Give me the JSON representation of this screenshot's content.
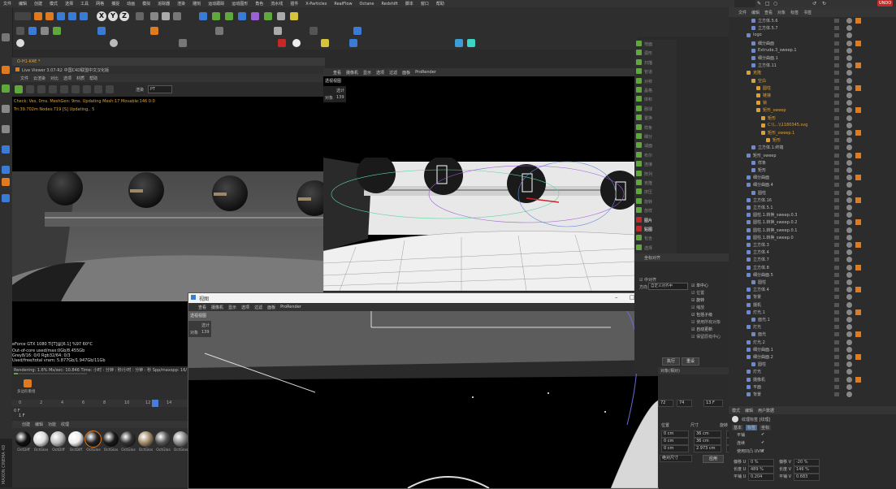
{
  "menubar": [
    "文件",
    "编辑",
    "创建",
    "模式",
    "选择",
    "工具",
    "网格",
    "捕捉",
    "动画",
    "模拟",
    "追踪器",
    "渲染",
    "雕刻",
    "运动跟踪",
    "运动图形",
    "角色",
    "流水线",
    "插件",
    "X-Particles",
    "RealFlow",
    "Octane",
    "Redshift",
    "脚本",
    "窗口",
    "帮助"
  ],
  "right_menu": [
    "文件",
    "编辑",
    "查看",
    "对象",
    "标签",
    "书签"
  ],
  "corner_badge": "UNDO",
  "toolbar_axis": [
    "X",
    "Y",
    "Z"
  ],
  "live_viewer": {
    "header_tab": "O-H1-K4E *",
    "title": "Live Viewer 3.07-R2 中国C4D联盟中文汉化版",
    "menus": [
      "文件",
      "云渲染",
      "对比",
      "选项",
      "材质",
      "帮助"
    ],
    "mode_label": "渲染",
    "mode_value": "PT",
    "status_line": "Check: Ves, 0ms. MeshGen: 9ms. Updating Mesh:17 Movable:146 0:0",
    "tri_line": "Tri:39.702m Nodes:719 [S] Updating..   5",
    "gpu_line": "eForce GTX 1080 Ti[T]@[6.1] %97     60°C",
    "core_line": "Out-of-core used/max:0Gb/8.455Gb",
    "rgb_line": "Grey8/16: 0/0          Rgb32/64: 0/3",
    "vram_line": "Used/free/total vram: 5.877Gb/1.947Gb/11Gb",
    "render_line": "Rendering: 1.6%   Ms/sec: 10.846   Time: 小时 : 分钟 : 秒/小时 : 分钟 : 秒   Spp/maxspp: 16/1000"
  },
  "viewport_top": {
    "menus": [
      "查看",
      "摄像机",
      "显示",
      "选项",
      "过滤",
      "面板",
      "ProRender"
    ],
    "label": "透视视图",
    "hud_label": "选计",
    "hud_obj": "对象",
    "hud_count": "139"
  },
  "viewport_float": {
    "window_title": "视图",
    "menus": [
      "查看",
      "摄像机",
      "显示",
      "选项",
      "过滤",
      "面板",
      "ProRender"
    ],
    "label": "透视视图",
    "hud_label": "选计",
    "hud_obj": "对象",
    "hud_count": "139"
  },
  "timeline": {
    "ticks": [
      "0",
      "2",
      "4",
      "6",
      "8",
      "10",
      "12",
      "14",
      "16",
      "18"
    ],
    "current": "1 F",
    "frame_a": "0 F",
    "label": "多边形重组"
  },
  "material_bar": {
    "menus": [
      "创建",
      "编辑",
      "功能",
      "纹理"
    ],
    "swatches": [
      "OctDiff",
      "OctGlos",
      "OctDiff",
      "OctDiff",
      "OctGlos",
      "OctGlos",
      "OctGlos",
      "OctGlos",
      "OctGlos",
      "OctGlos"
    ],
    "swatch_colors": [
      "#111",
      "#ddd",
      "#bbb",
      "#eee",
      "#222",
      "#1a1a1a",
      "#333",
      "#a08a6a",
      "#555",
      "#888"
    ],
    "logo": "MAXON CINEMA 4D"
  },
  "mid_panel": {
    "items": [
      "地面",
      "弧形",
      "扫描",
      "管道",
      "对称",
      "晶格",
      "体积",
      "融球",
      "置换",
      "样条",
      "细分",
      "减面",
      "布尔",
      "连接",
      "阵列",
      "克隆",
      "挤压",
      "旋转",
      "放样",
      "图片",
      "贴图",
      "包含",
      "选择"
    ],
    "highlighted": [
      "图片",
      "贴图"
    ],
    "section_title": "坐标对齐",
    "check_label": "中对齐",
    "dir_label": "方向",
    "dir_value": "自定义对齐中",
    "opts": [
      "单中心",
      "位置",
      "旋转",
      "缩放",
      "包括子级",
      "使用所有对象",
      "自动更新",
      "保留原有中心"
    ],
    "apply_btn": "执行",
    "reset_btn": "重设"
  },
  "coord_panel": {
    "tabs": [
      "位置",
      "尺寸",
      "旋转"
    ],
    "rows": [
      [
        "0 cm",
        "36 cm",
        "H 0°"
      ],
      [
        "0 cm",
        "36 cm",
        "P 0°"
      ],
      [
        "0 cm",
        "2.973 cm",
        "B 0°"
      ]
    ],
    "mode_select": "对象(相对)",
    "size_select": "绝对尺寸",
    "apply": "应用",
    "nums": [
      "72",
      "74",
      "13 F"
    ]
  },
  "object_list": {
    "items": [
      {
        "name": "立方体.5.6",
        "level": 1,
        "color": "#bcbcbc"
      },
      {
        "name": "立方体.5.7",
        "level": 1,
        "color": "#bcbcbc"
      },
      {
        "name": "logo",
        "level": 0,
        "color": "#bcbcbc"
      },
      {
        "name": "细分曲面",
        "level": 1,
        "color": "#bcbcbc"
      },
      {
        "name": "Extrude.3_sweep.1",
        "level": 1,
        "color": "#bcbcbc"
      },
      {
        "name": "细分曲面.1",
        "level": 1,
        "color": "#bcbcbc"
      },
      {
        "name": "立方体.11",
        "level": 1,
        "color": "#bcbcbc"
      },
      {
        "name": "克隆",
        "level": 0,
        "color": "#e0a030"
      },
      {
        "name": "空白",
        "level": 1,
        "color": "#e0a030"
      },
      {
        "name": "圆柱",
        "level": 2,
        "color": "#e0a030"
      },
      {
        "name": "链接",
        "level": 2,
        "color": "#e0a030"
      },
      {
        "name": "锁",
        "level": 2,
        "color": "#e0a030"
      },
      {
        "name": "矩形_sweep",
        "level": 2,
        "color": "#e0a030"
      },
      {
        "name": "矩形",
        "level": 3,
        "color": "#e0a030"
      },
      {
        "name": "C:\\\\...\\\\1180345.svg",
        "level": 3,
        "color": "#e0a030"
      },
      {
        "name": "矩形_sweep.1",
        "level": 3,
        "color": "#e0a030"
      },
      {
        "name": "矩形",
        "level": 4,
        "color": "#e0a030"
      },
      {
        "name": "立方体.1.终端",
        "level": 1,
        "color": "#bcbcbc"
      },
      {
        "name": "矩形_sweep",
        "level": 0,
        "color": "#bcbcbc"
      },
      {
        "name": "样条",
        "level": 1,
        "color": "#bcbcbc"
      },
      {
        "name": "矩形",
        "level": 1,
        "color": "#bcbcbc"
      },
      {
        "name": "细分曲面",
        "level": 0,
        "color": "#bcbcbc"
      },
      {
        "name": "细分曲面.4",
        "level": 0,
        "color": "#bcbcbc"
      },
      {
        "name": "圆柱",
        "level": 1,
        "color": "#bcbcbc"
      },
      {
        "name": "立方体.16",
        "level": 0,
        "color": "#bcbcbc"
      },
      {
        "name": "立方体.5.1",
        "level": 0,
        "color": "#bcbcbc"
      },
      {
        "name": "圆柱.1.转换_sweep.0.3",
        "level": 0,
        "color": "#bcbcbc"
      },
      {
        "name": "圆柱.1.转换_sweep.0.2",
        "level": 0,
        "color": "#bcbcbc"
      },
      {
        "name": "圆柱.1.转换_sweep.0.1",
        "level": 0,
        "color": "#bcbcbc"
      },
      {
        "name": "圆柱.1.转换_sweep.0",
        "level": 0,
        "color": "#bcbcbc"
      },
      {
        "name": "立方体.3",
        "level": 0,
        "color": "#bcbcbc"
      },
      {
        "name": "立方体.4",
        "level": 0,
        "color": "#bcbcbc"
      },
      {
        "name": "立方体.7",
        "level": 0,
        "color": "#bcbcbc"
      },
      {
        "name": "立方体.8",
        "level": 0,
        "color": "#bcbcbc"
      },
      {
        "name": "细分曲面.5",
        "level": 0,
        "color": "#bcbcbc"
      },
      {
        "name": "圆柱",
        "level": 1,
        "color": "#bcbcbc"
      },
      {
        "name": "立方体.4",
        "level": 0,
        "color": "#bcbcbc"
      },
      {
        "name": "背景",
        "level": 0,
        "color": "#bcbcbc"
      },
      {
        "name": "摄机",
        "level": 0,
        "color": "#bcbcbc"
      },
      {
        "name": "灯光.1",
        "level": 0,
        "color": "#bcbcbc"
      },
      {
        "name": "面光.1",
        "level": 1,
        "color": "#bcbcbc"
      },
      {
        "name": "灯光",
        "level": 0,
        "color": "#bcbcbc"
      },
      {
        "name": "面光",
        "level": 1,
        "color": "#bcbcbc"
      },
      {
        "name": "灯光.2",
        "level": 0,
        "color": "#bcbcbc"
      },
      {
        "name": "细分曲面.1",
        "level": 0,
        "color": "#bcbcbc"
      },
      {
        "name": "细分曲面.2",
        "level": 0,
        "color": "#bcbcbc"
      },
      {
        "name": "圆柱",
        "level": 1,
        "color": "#bcbcbc"
      },
      {
        "name": "灯光",
        "level": 0,
        "color": "#bcbcbc"
      },
      {
        "name": "摄像机",
        "level": 0,
        "color": "#bcbcbc"
      },
      {
        "name": "平面",
        "level": 0,
        "color": "#bcbcbc"
      },
      {
        "name": "背景",
        "level": 0,
        "color": "#bcbcbc"
      }
    ]
  },
  "attributes": {
    "menus": [
      "模式",
      "编辑",
      "用户数据"
    ],
    "title": "纹理标签 [纹理]",
    "tabs": [
      "基本",
      "标签",
      "坐标"
    ],
    "rows": [
      {
        "label": "平铺",
        "value": "✔"
      },
      {
        "label": "连续",
        "value": "✔"
      },
      {
        "label": "使用凹凸 UVW",
        "value": "✔"
      }
    ],
    "offset": [
      [
        "偏移 U",
        "0 %",
        "偏移 V",
        "-20 %"
      ],
      [
        "长度 U",
        "489 %",
        "长度 V",
        "146 %"
      ],
      [
        "平铺 U",
        "0.204",
        "平铺 V",
        "0.683"
      ]
    ]
  }
}
